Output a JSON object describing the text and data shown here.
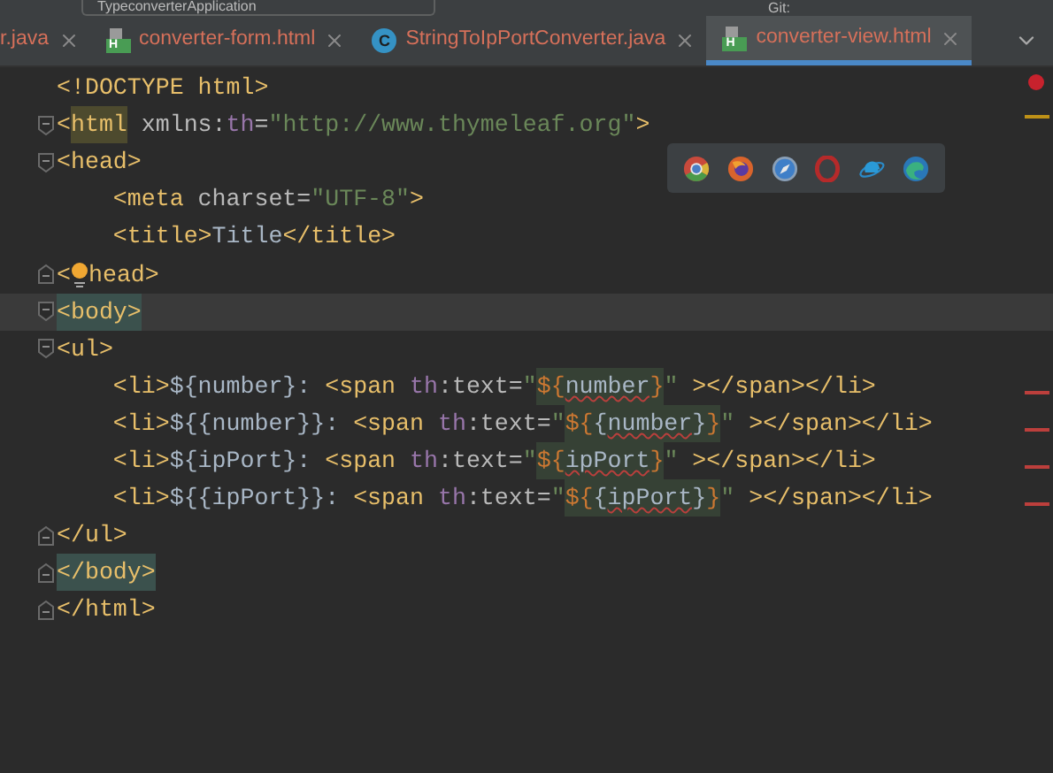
{
  "toolbar": {
    "run_config": "TypeconverterApplication",
    "vcs_label": "Git:"
  },
  "tabs": [
    {
      "label": "r.java",
      "selected": false
    },
    {
      "label": "converter-form.html",
      "icon": {
        "kind": "html",
        "letter": "H"
      },
      "selected": false
    },
    {
      "label": "StringToIpPortConverter.java",
      "icon": {
        "kind": "class",
        "letter": "C"
      },
      "selected": false
    },
    {
      "label": "converter-view.html",
      "icon": {
        "kind": "html",
        "letter": "H"
      },
      "selected": true
    }
  ],
  "editor": {
    "lines": [
      {
        "error_icon": true,
        "tokens": [
          {
            "text": "<!DOCTYPE html>",
            "kind": "tag"
          }
        ]
      },
      {
        "fold_start": true,
        "warning_stripe": true,
        "tokens": [
          {
            "text": "<",
            "kind": "tag"
          },
          {
            "text": "html",
            "kind": "tag",
            "brace_match": true
          },
          {
            "text": " xmlns:",
            "kind": "attr"
          },
          {
            "text": "th",
            "kind": "ns"
          },
          {
            "text": "=",
            "kind": "attr"
          },
          {
            "text": "\"http://www.thymeleaf.org\"",
            "kind": "string"
          },
          {
            "text": ">",
            "kind": "tag"
          }
        ]
      },
      {
        "fold_start": true,
        "tokens": [
          {
            "text": "<head>",
            "kind": "tag"
          }
        ]
      },
      {
        "tokens": [
          {
            "text": "    <meta ",
            "kind": "tag"
          },
          {
            "text": "charset=",
            "kind": "attr"
          },
          {
            "text": "\"UTF-8\"",
            "kind": "string"
          },
          {
            "text": ">",
            "kind": "tag"
          }
        ]
      },
      {
        "tokens": [
          {
            "text": "    <title>",
            "kind": "tag"
          },
          {
            "text": "Title",
            "kind": "plain"
          },
          {
            "text": "</title>",
            "kind": "tag"
          }
        ]
      },
      {
        "fold_end": true,
        "tokens": [
          {
            "text": "<",
            "kind": "tag"
          },
          {
            "kind": "bulb"
          },
          {
            "text": "head>",
            "kind": "tag"
          }
        ]
      },
      {
        "fold_start": true,
        "current": true,
        "tokens": [
          {
            "text": "<body>",
            "kind": "tag",
            "pair_match": true
          }
        ]
      },
      {
        "fold_start": true,
        "tokens": [
          {
            "text": "<ul>",
            "kind": "tag"
          }
        ]
      },
      {
        "error_stripe": true,
        "tokens": [
          {
            "text": "    <li>",
            "kind": "tag"
          },
          {
            "text": "${number}: ",
            "kind": "plain"
          },
          {
            "text": "<span ",
            "kind": "tag"
          },
          {
            "text": "th",
            "kind": "ns"
          },
          {
            "text": ":text=",
            "kind": "attr"
          },
          {
            "text": "\"",
            "kind": "string"
          },
          {
            "text": "${",
            "kind": "expr",
            "injected": true
          },
          {
            "text": "number",
            "kind": "plain",
            "injected": true,
            "typo": true
          },
          {
            "text": "}",
            "kind": "expr",
            "injected": true
          },
          {
            "text": "\"",
            "kind": "string"
          },
          {
            "text": " ></span></li>",
            "kind": "tag"
          }
        ]
      },
      {
        "error_stripe": true,
        "tokens": [
          {
            "text": "    <li>",
            "kind": "tag"
          },
          {
            "text": "${{number}}: ",
            "kind": "plain"
          },
          {
            "text": "<span ",
            "kind": "tag"
          },
          {
            "text": "th",
            "kind": "ns"
          },
          {
            "text": ":text=",
            "kind": "attr"
          },
          {
            "text": "\"",
            "kind": "string"
          },
          {
            "text": "${",
            "kind": "expr",
            "injected": true
          },
          {
            "text": "{",
            "kind": "plain",
            "injected": true
          },
          {
            "text": "number",
            "kind": "plain",
            "injected": true,
            "typo": true
          },
          {
            "text": "}",
            "kind": "plain",
            "injected": true
          },
          {
            "text": "}",
            "kind": "expr",
            "injected": true
          },
          {
            "text": "\"",
            "kind": "string"
          },
          {
            "text": " ></span></li>",
            "kind": "tag"
          }
        ]
      },
      {
        "error_stripe": true,
        "tokens": [
          {
            "text": "    <li>",
            "kind": "tag"
          },
          {
            "text": "${ipPort}: ",
            "kind": "plain"
          },
          {
            "text": "<span ",
            "kind": "tag"
          },
          {
            "text": "th",
            "kind": "ns"
          },
          {
            "text": ":text=",
            "kind": "attr"
          },
          {
            "text": "\"",
            "kind": "string"
          },
          {
            "text": "${",
            "kind": "expr",
            "injected": true
          },
          {
            "text": "ipPort",
            "kind": "plain",
            "injected": true,
            "typo": true
          },
          {
            "text": "}",
            "kind": "expr",
            "injected": true
          },
          {
            "text": "\"",
            "kind": "string"
          },
          {
            "text": " ></span></li>",
            "kind": "tag"
          }
        ]
      },
      {
        "error_stripe": true,
        "tokens": [
          {
            "text": "    <li>",
            "kind": "tag"
          },
          {
            "text": "${{ipPort}}: ",
            "kind": "plain"
          },
          {
            "text": "<span ",
            "kind": "tag"
          },
          {
            "text": "th",
            "kind": "ns"
          },
          {
            "text": ":text=",
            "kind": "attr"
          },
          {
            "text": "\"",
            "kind": "string"
          },
          {
            "text": "${",
            "kind": "expr",
            "injected": true
          },
          {
            "text": "{",
            "kind": "plain",
            "injected": true
          },
          {
            "text": "ipPort",
            "kind": "plain",
            "injected": true,
            "typo": true
          },
          {
            "text": "}",
            "kind": "plain",
            "injected": true
          },
          {
            "text": "}",
            "kind": "expr",
            "injected": true
          },
          {
            "text": "\"",
            "kind": "string"
          },
          {
            "text": " ></span></li>",
            "kind": "tag"
          }
        ]
      },
      {
        "fold_end": true,
        "tokens": [
          {
            "text": "</ul>",
            "kind": "tag"
          }
        ]
      },
      {
        "fold_end": true,
        "tokens": [
          {
            "text": "</body>",
            "kind": "tag",
            "pair_match": true
          }
        ]
      },
      {
        "fold_end": true,
        "tokens": [
          {
            "text": "</html>",
            "kind": "tag"
          }
        ]
      }
    ]
  },
  "browser_popup": {
    "browsers": [
      {
        "kind": "chrome"
      },
      {
        "kind": "firefox"
      },
      {
        "kind": "safari"
      },
      {
        "kind": "opera"
      },
      {
        "kind": "ie"
      },
      {
        "kind": "edge"
      }
    ]
  }
}
